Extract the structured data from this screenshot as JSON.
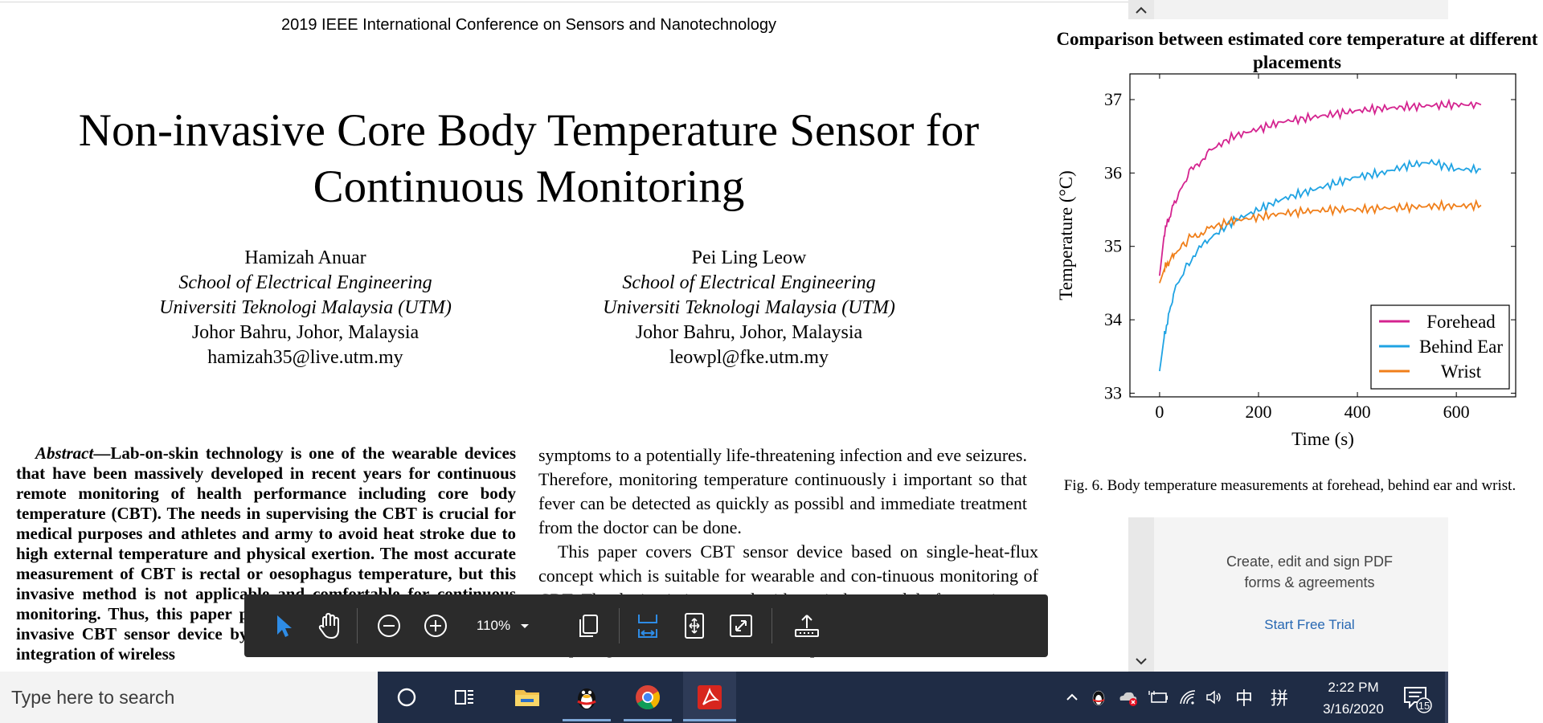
{
  "pdf": {
    "header": "2019 IEEE International Conference on Sensors and Nanotechnology",
    "title_line1": "Non-invasive Core Body Temperature Sensor for",
    "title_line2": "Continuous Monitoring",
    "authors": [
      {
        "name": "Hamizah Anuar",
        "school": "School of Electrical Engineering",
        "university": "Universiti Teknologi Malaysia (UTM)",
        "location": "Johor Bahru, Johor, Malaysia",
        "email": "hamizah35@live.utm.my"
      },
      {
        "name": "Pei Ling Leow",
        "school": "School of Electrical Engineering",
        "university": "Universiti Teknologi Malaysia (UTM)",
        "location": "Johor Bahru, Johor, Malaysia",
        "email": "leowpl@fke.utm.my"
      }
    ],
    "abstract_label": "Abstract",
    "abstract_text": "—Lab-on-skin technology is one of the wearable devices that have been massively developed in recent years for continuous remote monitoring of health performance including core body temperature (CBT). The needs in supervising the CBT is crucial for medical purposes and athletes and army to avoid heat stroke due to high external temperature and physical exertion. The most accurate measurement of CBT is rectal or oesophagus temperature, but this invasive method is not applicable and comfortable for continuous monitoring. Thus, this paper proposes a new development of non-invasive CBT sensor device by using single-heat-flux concept with integration of wireless",
    "body_p1": "symptoms to a potentially life-threatening infection and eve seizures. Therefore, monitoring temperature continuously i important so that fever can be detected as quickly as possibl and immediate treatment from the doctor can be done.",
    "body_p2": "This paper covers CBT sensor device based on single-heat-flux concept which is suitable for wearable and con-tinuous monitoring of CBT. The device is integrated with a wireless module for continuous monitoring. A validation of the CBT device is performed by comparing measurements from developed CBT device and",
    "figure_caption": "Fig. 6.  Body temperature measurements at forehead, behind ear and wrist."
  },
  "chart_data": {
    "type": "line",
    "title": "Comparison between estimated core temperature at different placements",
    "xlabel": "Time (s)",
    "ylabel": "Temperature (°C)",
    "xlim": [
      -60,
      720
    ],
    "ylim": [
      32.95,
      37.35
    ],
    "xticks": [
      "0",
      "200",
      "400",
      "600"
    ],
    "yticks": [
      "33",
      "34",
      "35",
      "36",
      "37"
    ],
    "legend_position": "bottom-right",
    "series": [
      {
        "name": "Forehead",
        "color": "#d4238f",
        "x": [
          0,
          10,
          30,
          60,
          100,
          150,
          200,
          250,
          300,
          350,
          400,
          450,
          500,
          550,
          600,
          650
        ],
        "y": [
          34.6,
          35.2,
          35.6,
          36.0,
          36.3,
          36.5,
          36.6,
          36.7,
          36.75,
          36.8,
          36.85,
          36.88,
          36.9,
          36.92,
          36.93,
          36.93
        ]
      },
      {
        "name": "Behind Ear",
        "color": "#1fa3e3",
        "x": [
          0,
          10,
          30,
          60,
          100,
          150,
          200,
          250,
          300,
          350,
          400,
          450,
          500,
          550,
          600,
          650
        ],
        "y": [
          33.3,
          33.8,
          34.4,
          34.8,
          35.1,
          35.35,
          35.5,
          35.65,
          35.75,
          35.85,
          35.95,
          36.0,
          36.1,
          36.15,
          36.05,
          36.05
        ]
      },
      {
        "name": "Wrist",
        "color": "#f07f1a",
        "x": [
          0,
          10,
          30,
          60,
          100,
          150,
          200,
          250,
          300,
          350,
          400,
          450,
          500,
          550,
          600,
          650
        ],
        "y": [
          34.5,
          34.7,
          34.9,
          35.1,
          35.25,
          35.35,
          35.4,
          35.45,
          35.48,
          35.5,
          35.5,
          35.52,
          35.53,
          35.55,
          35.55,
          35.56
        ]
      }
    ]
  },
  "ad": {
    "line1": "Create, edit and sign PDF",
    "line2": "forms & agreements",
    "link": "Start Free Trial"
  },
  "toolbar": {
    "zoom": "110%"
  },
  "taskbar": {
    "search_placeholder": "Type here to search",
    "ime_lang": "中",
    "ime_mode": "拼",
    "time": "2:22 PM",
    "date": "3/16/2020",
    "notifications": "15"
  }
}
